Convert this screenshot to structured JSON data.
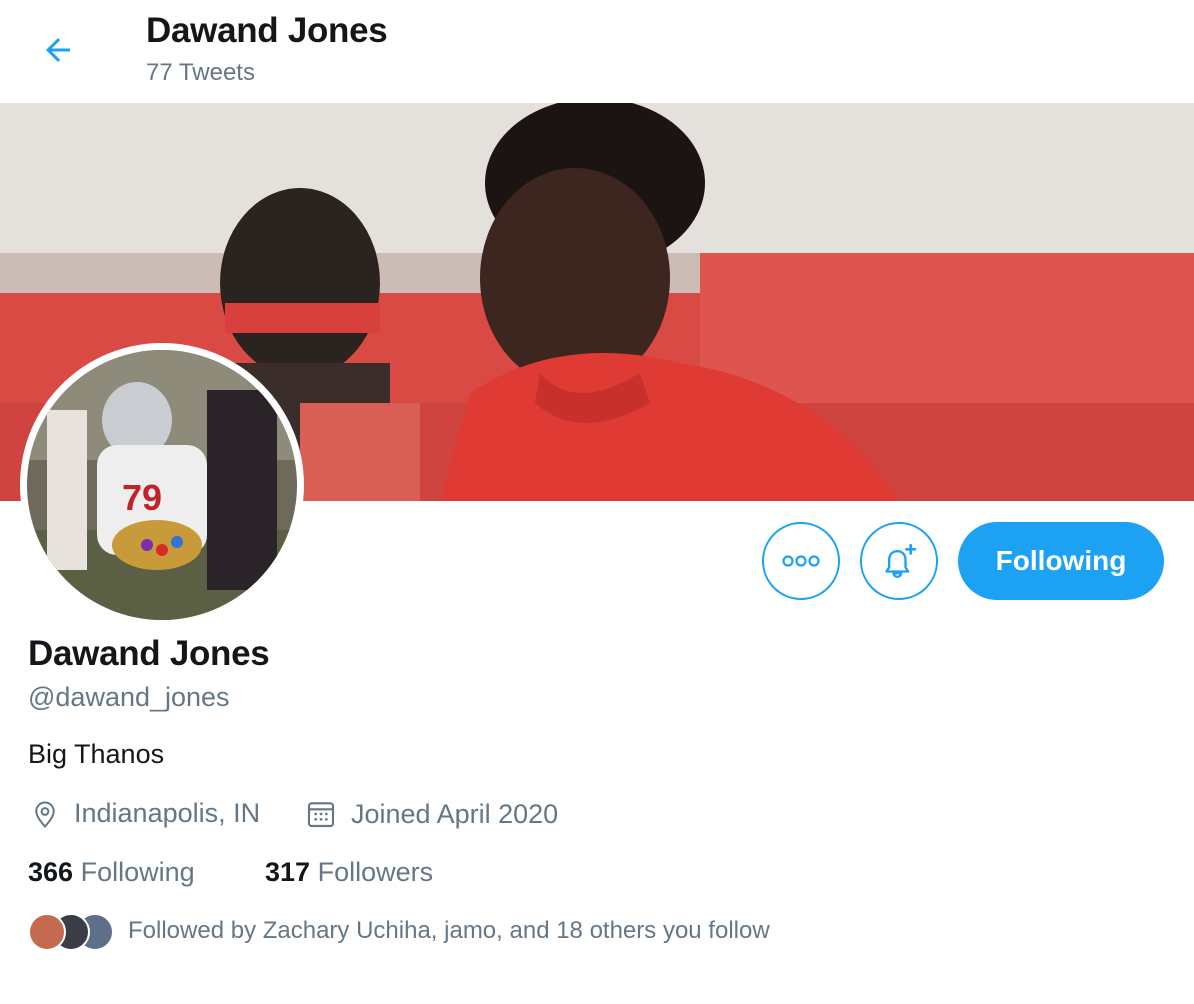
{
  "header": {
    "back_icon": "arrow-left-icon",
    "name": "Dawand Jones",
    "tweet_count": "77 Tweets"
  },
  "profile": {
    "name": "Dawand Jones",
    "handle": "@dawand_jones",
    "bio": "Big Thanos",
    "location": "Indianapolis, IN",
    "joined": "Joined April 2020",
    "following_count": "366",
    "following_label": "Following",
    "followers_count": "317",
    "followers_label": "Followers",
    "followed_by": "Followed by Zachary Uchiha, jamo, and 18 others you follow"
  },
  "actions": {
    "more_icon": "more-dots-icon",
    "notify_icon": "bell-plus-icon",
    "follow_label": "Following"
  },
  "colors": {
    "accent": "#1da1f2",
    "text_primary": "#14171a",
    "text_secondary": "#657786"
  }
}
